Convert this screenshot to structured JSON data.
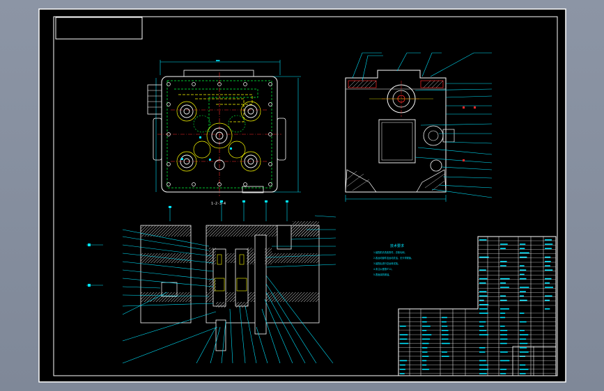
{
  "colors": {
    "background_chrome": "#8a93a3",
    "paper": "#000000",
    "frame": "#ffffff",
    "dimension": "#00e5ff",
    "center_line": "#ff2a2a",
    "hidden_line": "#00ff3c",
    "highlight": "#ffff00",
    "section": "#d0d0d0"
  },
  "drawing": {
    "section_label": "1-2-3-4",
    "notes_title": "技术要求",
    "notes_lines": [
      "1.装配前清洗各零件，去除毛刺。",
      "2.各运动部件应运动灵活，无卡滞现象。",
      "3.装配后进行空运转试验。",
      "4.未注公差按IT12。",
      "5.表面涂防锈油。"
    ]
  }
}
